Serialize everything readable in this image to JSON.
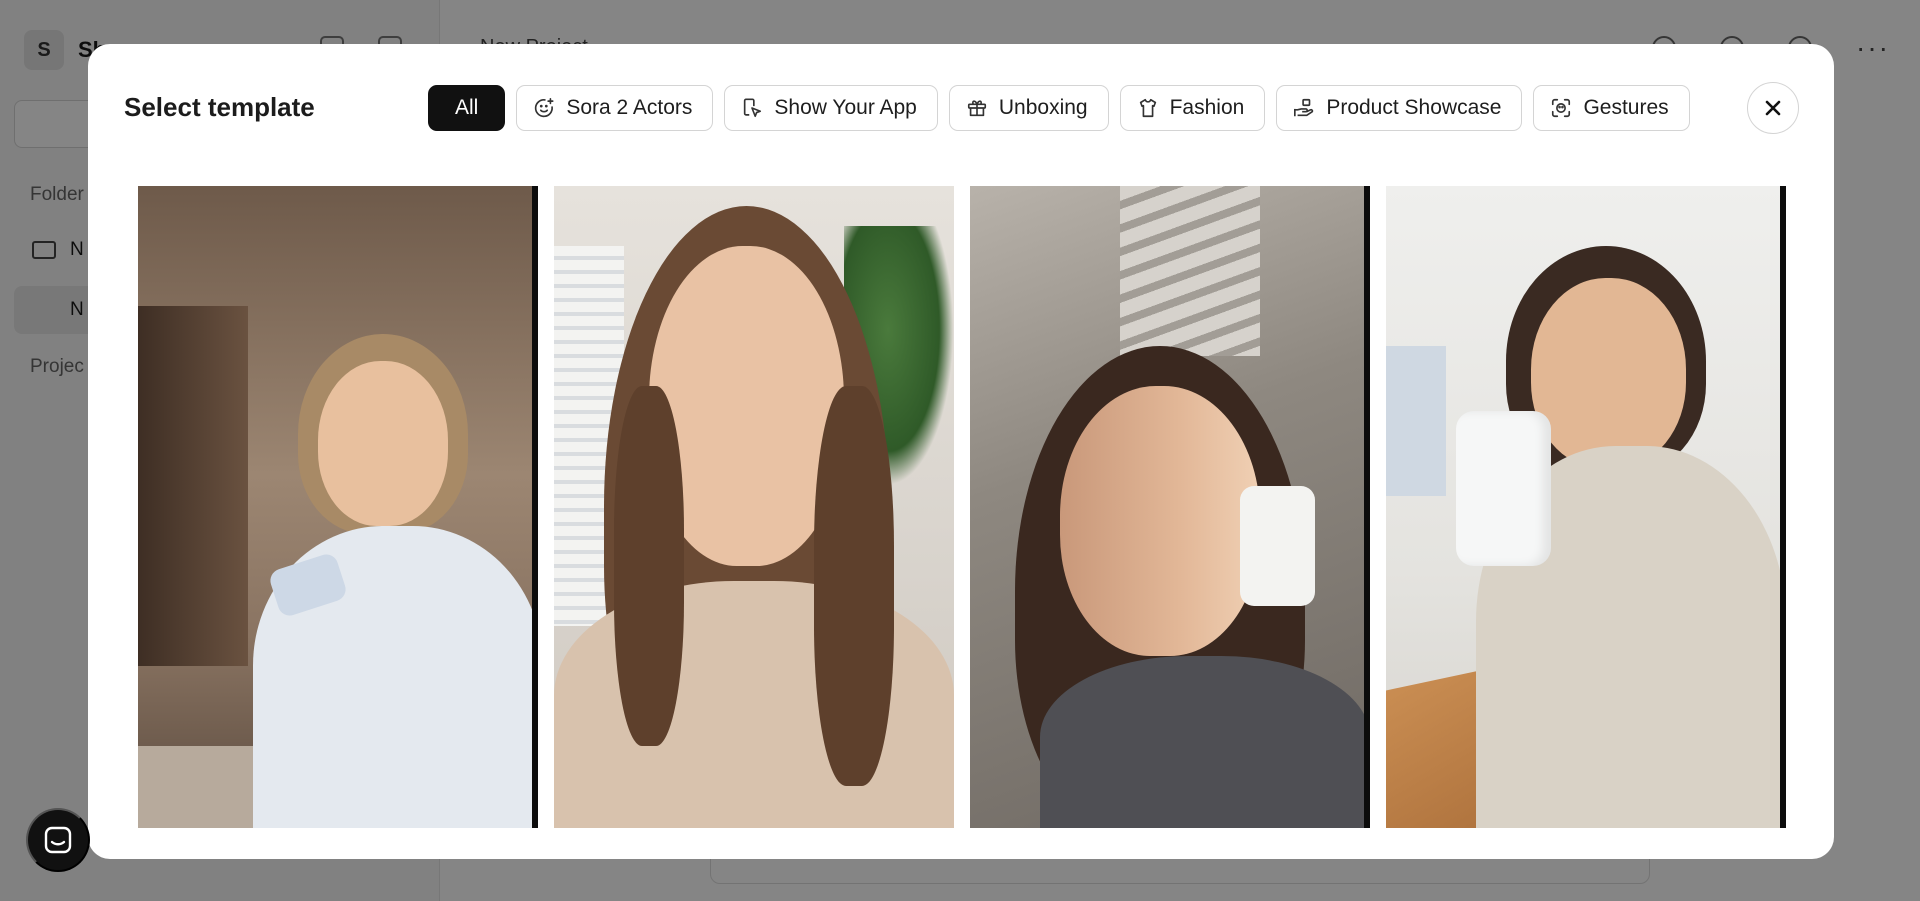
{
  "background": {
    "workspace_initial": "S",
    "workspace_name": "Sh",
    "sidebar_heading_folders": "Folder",
    "sidebar_folder_label": "N",
    "sidebar_active_label": "N",
    "sidebar_heading_projects": "Projec",
    "main_title": "New Project"
  },
  "modal": {
    "title": "Select template",
    "filters": [
      {
        "label": "All",
        "icon": "none",
        "active": true
      },
      {
        "label": "Sora 2 Actors",
        "icon": "smile-sparkle-icon",
        "active": false
      },
      {
        "label": "Show Your App",
        "icon": "phone-tap-icon",
        "active": false
      },
      {
        "label": "Unboxing",
        "icon": "gift-icon",
        "active": false
      },
      {
        "label": "Fashion",
        "icon": "tshirt-icon",
        "active": false
      },
      {
        "label": "Product Showcase",
        "icon": "hand-box-icon",
        "active": false
      },
      {
        "label": "Gestures",
        "icon": "face-scan-icon",
        "active": false
      }
    ],
    "close_icon": "close-icon",
    "templates": [
      {
        "subject": "woman in white sweatshirt laughing holding a packet in a living room",
        "palette": {
          "bg": "#8c7866",
          "hair": "#a98a66",
          "skin": "#e9c3a2",
          "body": "#e3e8ee",
          "prop": "#cfd9e6"
        }
      },
      {
        "subject": "woman with long brown hair in beige sweater, plant behind",
        "palette": {
          "bg": "#dcd8d2",
          "hair": "#6a4a34",
          "skin": "#e8c1a3",
          "body": "#d8c3ae",
          "prop": "#3e6a35"
        }
      },
      {
        "subject": "woman in sunlight holding white bottle",
        "palette": {
          "bg": "#9a948d",
          "hair": "#3c2a22",
          "skin": "#d8aa88",
          "body": "#5a5a5e",
          "prop": "#f2f2f0"
        }
      },
      {
        "subject": "woman in kitchen holding a white supplement jar",
        "palette": {
          "bg": "#e8e8e6",
          "hair": "#3a2a22",
          "skin": "#e2b796",
          "body": "#d9d2c6",
          "prop": "#f4f5f5"
        }
      }
    ]
  },
  "chat": {
    "icon": "chat-icon"
  }
}
